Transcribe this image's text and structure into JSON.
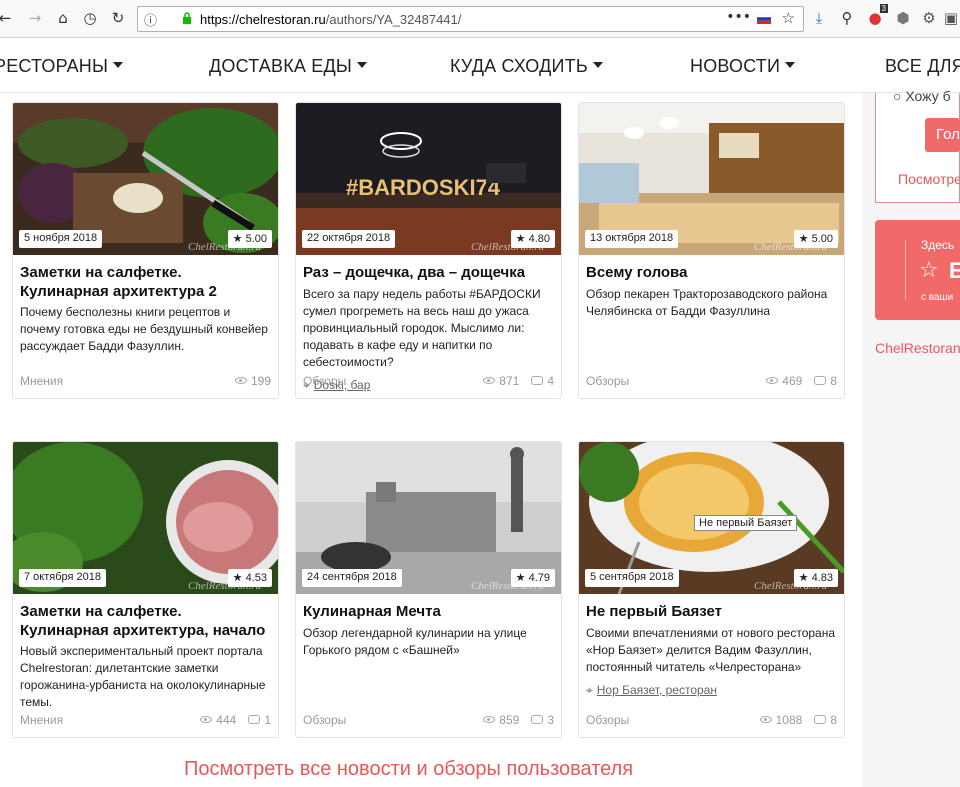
{
  "browser": {
    "url_host": "https://chelrestoran.ru",
    "url_path": "/authors/YA_32487441/",
    "dots": "•••",
    "ext_badge": "3",
    "colors": {
      "accent": "#e8585a"
    }
  },
  "nav": {
    "items": [
      {
        "label": "РЕСТОРАНЫ"
      },
      {
        "label": "ДОСТАВКА ЕДЫ"
      },
      {
        "label": "КУДА СХОДИТЬ"
      },
      {
        "label": "НОВОСТИ"
      },
      {
        "label": "ВСЕ ДЛЯ"
      }
    ]
  },
  "cards": [
    {
      "date": "5 ноября 2018",
      "rating": "5.00",
      "title": "Заметки на салфетке. Кулинарная архитектура 2",
      "desc": "Почему бесполезны книги рецептов и почему готовка еды не бездушный конвейер рассуждает Бадди Фазуллин.",
      "location": "",
      "category": "Мнения",
      "views": "199",
      "comments": ""
    },
    {
      "date": "22 октября 2018",
      "rating": "4.80",
      "title": "Раз – дощечка, два – дощечка",
      "desc": "Всего за пару недель работы #БАРДОСКИ сумел прогреметь на весь наш до ужаса провинциальный городок. Мыслимо ли: подавать в кафе еду и напитки по себестоимости?",
      "location": "Doski, бар",
      "category": "Обзоры",
      "views": "871",
      "comments": "4"
    },
    {
      "date": "13 октября 2018",
      "rating": "5.00",
      "title": "Всему голова",
      "desc": "Обзор пекарен Тракторозаводского района Челябинска от Бадди Фазуллина",
      "location": "",
      "category": "Обзоры",
      "views": "469",
      "comments": "8"
    },
    {
      "date": "7 октября 2018",
      "rating": "4.53",
      "title": "Заметки на салфетке. Кулинарная архитектура, начало",
      "desc": "Новый экспериментальный проект портала Chelrestoran: дилетантские заметки горожанина-урбаниста на околокулинарные темы.",
      "location": "",
      "category": "Мнения",
      "views": "444",
      "comments": "1"
    },
    {
      "date": "24 сентября 2018",
      "rating": "4.79",
      "title": "Кулинарная Мечта",
      "desc": "Обзор легендарной кулинарии на улице Горького рядом с «Башней»",
      "location": "",
      "category": "Обзоры",
      "views": "859",
      "comments": "3"
    },
    {
      "date": "5 сентября 2018",
      "rating": "4.83",
      "title": "Не первый Баязет",
      "desc": "Своими впечатлениями от нового ресторана «Нор Баязет» делится Вадим Фазуллин, постоянный читатель «Челресторана»",
      "location": "Нор Баязет, ресторан",
      "category": "Обзоры",
      "views": "1088",
      "comments": "8",
      "tooltip": "Не первый Баязет"
    }
  ],
  "watermark": "ChelRestoran.ru",
  "all_link": "Посмотреть все новости и обзоры пользователя",
  "sidebar": {
    "radio_text": "Хожу б",
    "button": "Гол",
    "more": "Посмотре",
    "promo_line1": "Здесь",
    "promo_big": "Б",
    "promo_line2": "с ваши",
    "site": "ChelRestoran"
  }
}
